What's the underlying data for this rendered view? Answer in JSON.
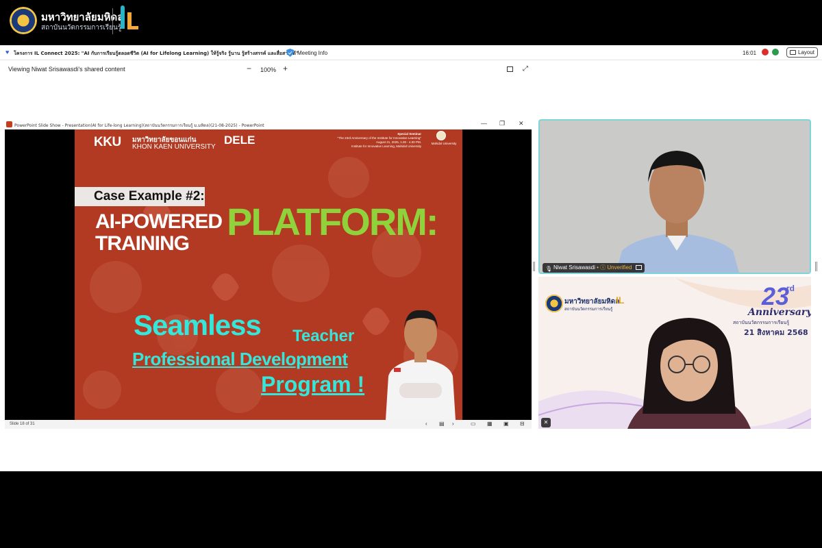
{
  "brand": {
    "university_th": "มหาวิทยาลัยมหิดล",
    "institute_th": "สถาบันนวัตกรรมการเรียนรู้"
  },
  "meeting": {
    "title": "โครงการ IL Connect 2025:  \"AI กับการเรียนรู้ตลอดชีวิต (AI for Lifelong Learning) ให้รู้จริง รู้นาน รู้สร้างสรรค์ และสื่อสารได้\"",
    "info_label": "Meeting Info",
    "time": "16:01",
    "layout_label": "Layout"
  },
  "share": {
    "viewing_text": "Viewing Niwat Srisawasdi's shared content",
    "zoom_minus": "−",
    "zoom_level": "100%",
    "zoom_plus": "+"
  },
  "ppt": {
    "window_title": "PowerPoint Slide Show  -  Presentation(AI for Life-long Learning)(สถาบันนวัตกรรมการเรียนรู้ ม.มหิดล)(21-08-2025) - PowerPoint",
    "status": "Slide 18 of 31"
  },
  "slide": {
    "kku_short": "KKU",
    "kku_thai": "มหาวิทยาลัยขอนแก่น",
    "kku_en": "KHON KAEN UNIVERSITY",
    "dele": "DELE",
    "seminar_title": "Special Seminar",
    "seminar_sub": "\"The 23rd Anniversary of the Institute for Innovative Learning\"",
    "seminar_date": "August 21, 2025, 1.00 - 4.00 PM.",
    "seminar_place": "Institute for Innovative Learning, Mahidol University",
    "mahidol_caption": "Mahidol University",
    "case": "Case Example #2:",
    "ai_powered": "AI-POWERED",
    "training": "TRAINING",
    "platform": "PLATFORM:",
    "seamless": "Seamless",
    "teacher": "Teacher",
    "pro_dev": "Professional Development",
    "program": "Program !"
  },
  "participants": {
    "p1_name": "Niwat Srisawasdi",
    "p1_status": "Unverified",
    "anniv_num": "23",
    "anniv_rd": "rd",
    "anniv_word": "Anniversary",
    "anniv_inst": "สถาบันนวัตกรรมการเรียนรู้",
    "anniv_date": "21 สิงหาคม 2568",
    "t2_il": "IL"
  },
  "colors": {
    "slide_bg": "#b23a22",
    "platform_green": "#8fd23c",
    "cyan": "#35e7da",
    "active_speaker": "#7fd4d8"
  }
}
